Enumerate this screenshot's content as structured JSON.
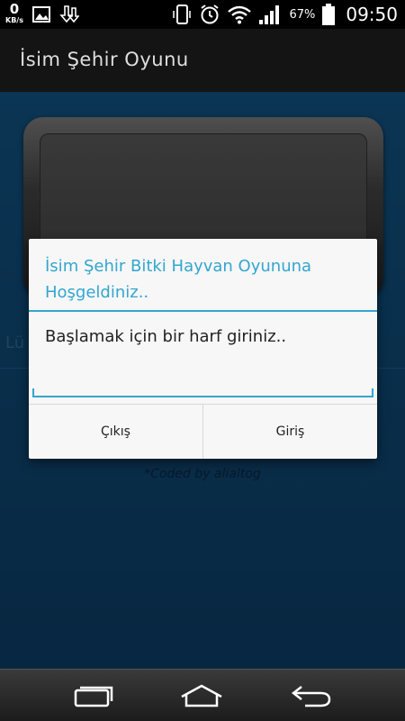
{
  "status_bar": {
    "net_speed": "0",
    "net_unit": "KB/s",
    "battery_percent": "67%",
    "time": "09:50",
    "icons": [
      "image-icon",
      "download-icon",
      "vibrate-icon",
      "alarm-icon",
      "wifi-icon",
      "signal-icon",
      "battery-icon"
    ]
  },
  "app_bar": {
    "title": "İsim Şehir Oyunu"
  },
  "background": {
    "partial_text": "Lü",
    "credit": "*Coded by alialtog"
  },
  "dialog": {
    "title": "İsim Şehir Bitki Hayvan Oyununa Hoşgeldiniz..",
    "message": "Başlamak için bir harf giriniz..",
    "input_value": "",
    "negative_button": "Çıkış",
    "positive_button": "Giriş"
  },
  "nav_bar": {
    "icons": [
      "recent-apps-icon",
      "home-icon",
      "back-icon"
    ]
  },
  "colors": {
    "accent": "#33a6cf",
    "background": "#0d4066",
    "app_bar": "#141414"
  }
}
